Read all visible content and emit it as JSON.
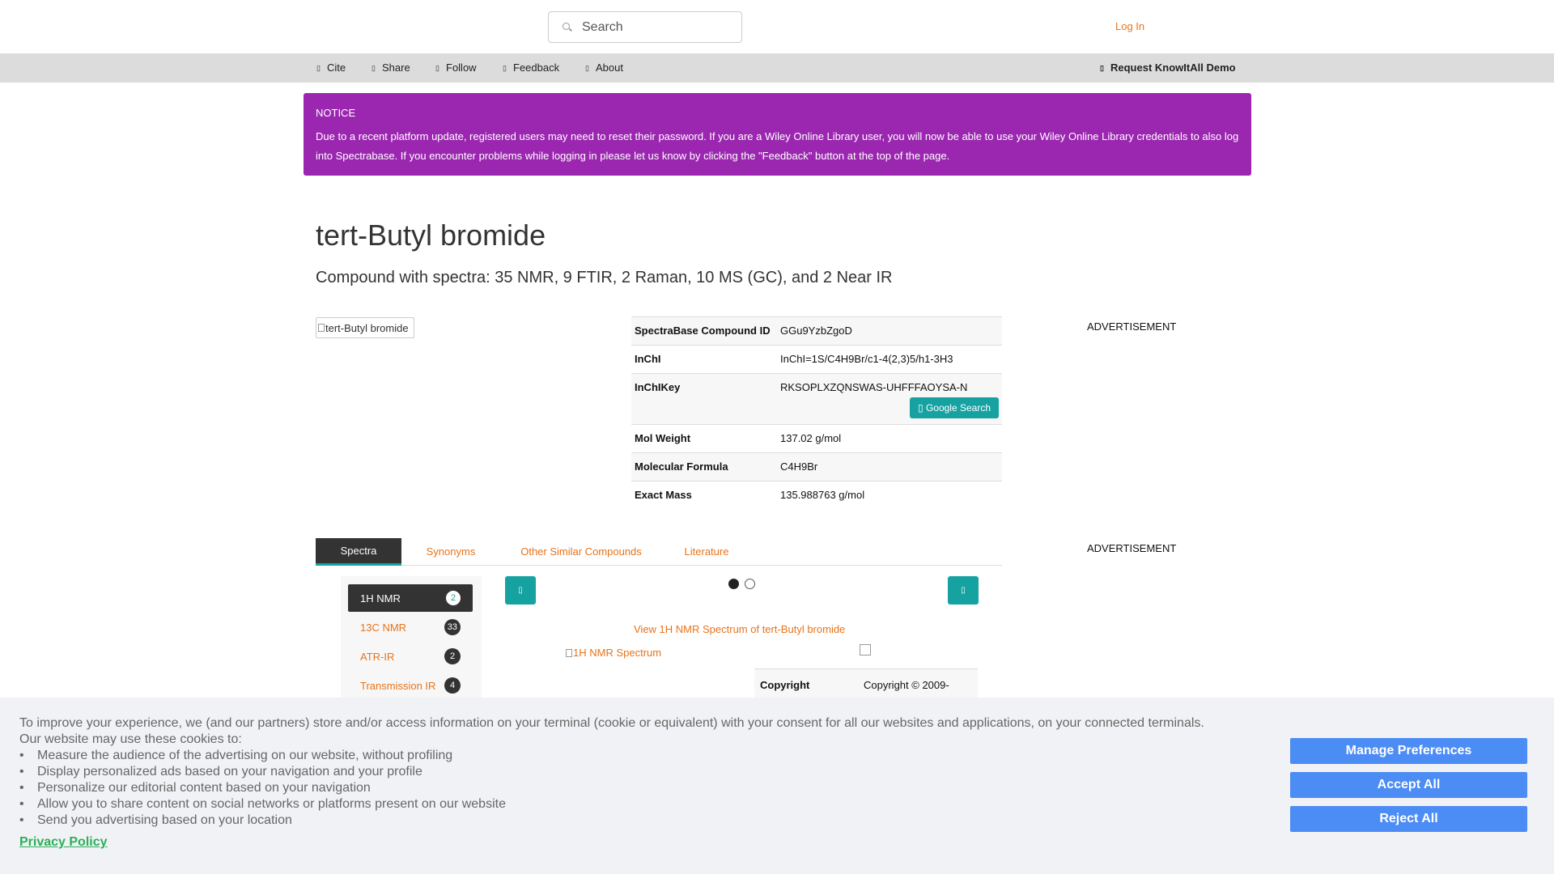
{
  "header": {
    "search_placeholder": "Search",
    "login": "Log In"
  },
  "nav": {
    "items": [
      "Cite",
      "Share",
      "Follow",
      "Feedback",
      "About"
    ],
    "right": "Request KnowItAll Demo"
  },
  "notice": {
    "title": "NOTICE",
    "text": "Due to a recent platform update, registered users may need to reset their password. If you are a Wiley Online Library user, you will now be able to use your Wiley Online Library credentials to also log into Spectrabase. If you encounter problems while logging in please let us know by clicking the \"Feedback\" button at the top of the page."
  },
  "compound": {
    "title": "tert-Butyl bromide",
    "subtitle": "Compound with spectra: 35 NMR, 9 FTIR, 2 Raman, 10 MS (GC), and 2 Near IR",
    "image_alt": "tert-Butyl bromide"
  },
  "properties": [
    {
      "key": "SpectraBase Compound ID",
      "value": "GGu9YzbZgoD"
    },
    {
      "key": "InChI",
      "value": "InChI=1S/C4H9Br/c1-4(2,3)5/h1-3H3"
    },
    {
      "key": "InChIKey",
      "value": "RKSOPLXZQNSWAS-UHFFFAOYSA-N"
    },
    {
      "key": "Mol Weight",
      "value": "137.02 g/mol"
    },
    {
      "key": "Molecular Formula",
      "value": "C4H9Br"
    },
    {
      "key": "Exact Mass",
      "value": "135.988763 g/mol"
    }
  ],
  "google_search": "Google Search",
  "ads": [
    "ADVERTISEMENT",
    "ADVERTISEMENT"
  ],
  "tabs": [
    "Spectra",
    "Synonyms",
    "Other Similar Compounds",
    "Literature"
  ],
  "spectra_types": [
    {
      "label": "1H NMR",
      "count": "2"
    },
    {
      "label": "13C NMR",
      "count": "33"
    },
    {
      "label": "ATR-IR",
      "count": "2"
    },
    {
      "label": "Transmission IR",
      "count": "4"
    }
  ],
  "carousel": {
    "view_link": "View 1H NMR Spectrum of tert-Butyl bromide",
    "image_alt": "1H NMR Spectrum",
    "copyright_key": "Copyright",
    "copyright_value": "Copyright © 2009-"
  },
  "cookie": {
    "intro_line1": "To improve your experience, we (and our partners) store and/or access information on your terminal (cookie or equivalent) with your consent for all our websites and applications, on your connected terminals.",
    "intro_line2": "Our website may use these cookies to:",
    "items": [
      "Measure the audience of the advertising on our website, without profiling",
      "Display personalized ads based on your navigation and your profile",
      "Personalize our editorial content based on your navigation",
      "Allow you to share content on social networks or platforms present on our website",
      "Send you advertising based on your location"
    ],
    "privacy": "Privacy Policy",
    "buttons": [
      "Manage Preferences",
      "Accept All",
      "Reject All"
    ]
  },
  "colors": {
    "accent_orange": "#e8731a",
    "teal": "#17a2a2",
    "notice_purple": "#9b27b0",
    "cookie_blue": "#4c8cf5",
    "privacy_green": "#2ab058"
  }
}
